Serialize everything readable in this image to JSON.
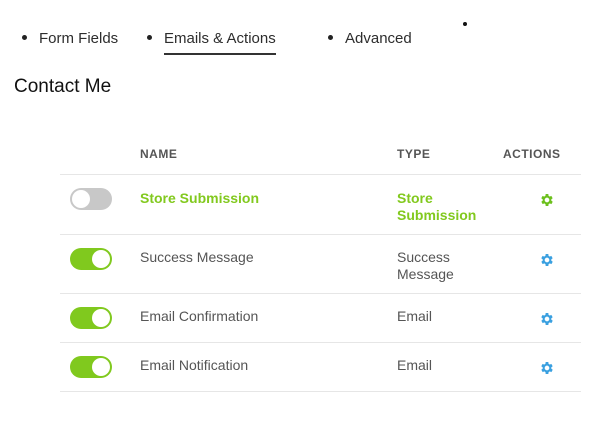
{
  "colors": {
    "accent_green": "#80c91e",
    "gear_green": "#6cc01d",
    "gear_blue": "#3aa0e0",
    "toggle_off": "#c8c8c8"
  },
  "tabs": [
    {
      "label": "Form Fields",
      "active": false
    },
    {
      "label": "Emails & Actions",
      "active": true
    },
    {
      "label": "Advanced",
      "active": false
    }
  ],
  "form": {
    "title": "Contact Me"
  },
  "table": {
    "headers": {
      "name": "NAME",
      "type": "TYPE",
      "actions": "ACTIONS"
    },
    "rows": [
      {
        "enabled": false,
        "name": "Store Submission",
        "type": "Store Submission",
        "settings_icon": "gear-icon",
        "settings_color": "green"
      },
      {
        "enabled": true,
        "name": "Success Message",
        "type": "Success Message",
        "settings_icon": "gear-icon",
        "settings_color": "blue"
      },
      {
        "enabled": true,
        "name": "Email Confirmation",
        "type": "Email",
        "settings_icon": "gear-icon",
        "settings_color": "blue"
      },
      {
        "enabled": true,
        "name": "Email Notification",
        "type": "Email",
        "settings_icon": "gear-icon",
        "settings_color": "blue"
      }
    ]
  }
}
